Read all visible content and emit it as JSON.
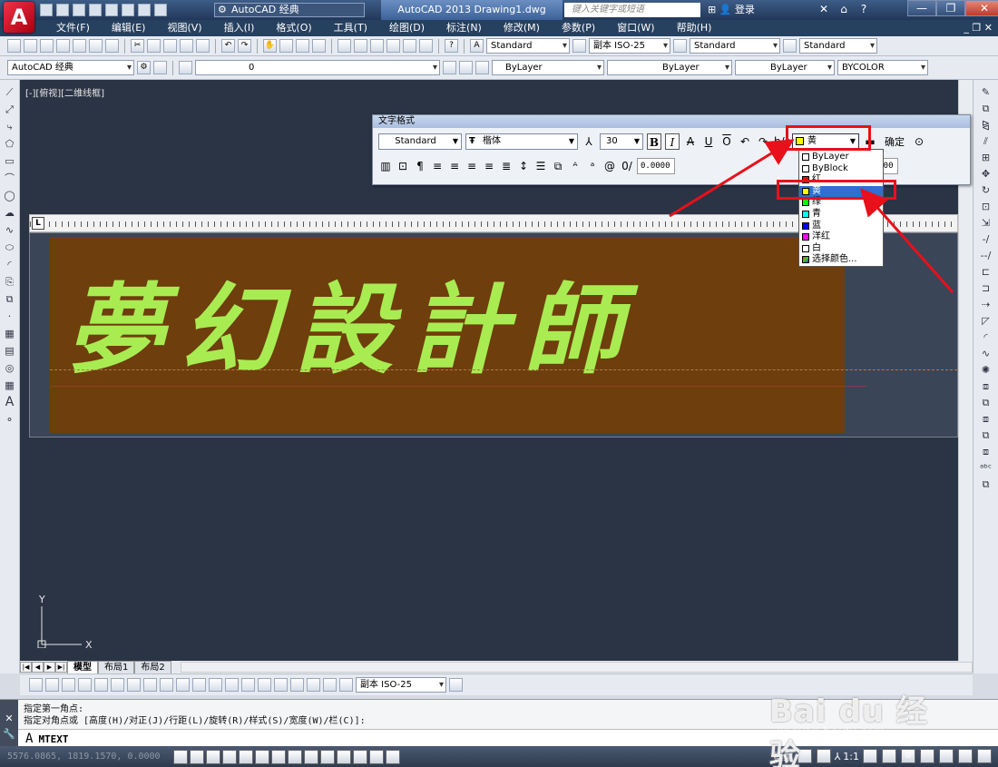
{
  "titlebar": {
    "logo": "A",
    "workspace": "AutoCAD 经典",
    "doc_title": "AutoCAD 2013   Drawing1.dwg",
    "search_placeholder": "键入关键字或短语",
    "login": "登录"
  },
  "menu": [
    "文件(F)",
    "编辑(E)",
    "视图(V)",
    "插入(I)",
    "格式(O)",
    "工具(T)",
    "绘图(D)",
    "标注(N)",
    "修改(M)",
    "参数(P)",
    "窗口(W)",
    "帮助(H)"
  ],
  "toolbar1": {
    "text_style": "Standard",
    "dim_style": "副本 ISO-25",
    "table_style": "Standard",
    "mleader_style": "Standard"
  },
  "toolbar2": {
    "workspace": "AutoCAD 经典",
    "layer": "0",
    "color": "ByLayer",
    "linetype": "ByLayer",
    "lineweight": "ByLayer",
    "plotstyle": "BYCOLOR"
  },
  "canvas": {
    "view_label": "[-][俯视][二维线框]",
    "mtext": "夢幻設計師",
    "ucs_y": "Y",
    "ucs_x": "X"
  },
  "text_format": {
    "title": "文字格式",
    "style": "Standard",
    "font": "楷体",
    "height": "30",
    "color_selected": "黄",
    "ok": "确定",
    "oblique": "0.0000",
    "width_factor": "1.0000"
  },
  "color_list": [
    {
      "label": "ByLayer",
      "color": "#ffffff"
    },
    {
      "label": "ByBlock",
      "color": "#ffffff"
    },
    {
      "label": "红",
      "color": "#ff0000"
    },
    {
      "label": "黄",
      "color": "#ffff00",
      "selected": true
    },
    {
      "label": "绿",
      "color": "#00ff00"
    },
    {
      "label": "青",
      "color": "#00ffff"
    },
    {
      "label": "蓝",
      "color": "#0000ff"
    },
    {
      "label": "洋红",
      "color": "#ff00ff"
    },
    {
      "label": "白",
      "color": "#ffffff"
    },
    {
      "label": "选择颜色...",
      "color": "#3366cc"
    }
  ],
  "layout_tabs": [
    "模型",
    "布局1",
    "布局2"
  ],
  "dim_style": "副本 ISO-25",
  "command": {
    "line1": "指定第一角点:",
    "line2": "指定对角点或 [高度(H)/对正(J)/行距(L)/旋转(R)/样式(S)/宽度(W)/栏(C)]:",
    "input": "MTEXT"
  },
  "status": {
    "coords": "5576.0865, 1819.1570, 0.0000",
    "model": "模型",
    "scale": "1:1"
  },
  "watermark": {
    "brand": "Bai du 经验",
    "url": "jingyan.baidu.com"
  },
  "colors": {
    "mtext": "#a8ec52",
    "text_bg": "#6e3e0c",
    "canvas": "#2a3444",
    "annotation": "#e8101a"
  }
}
